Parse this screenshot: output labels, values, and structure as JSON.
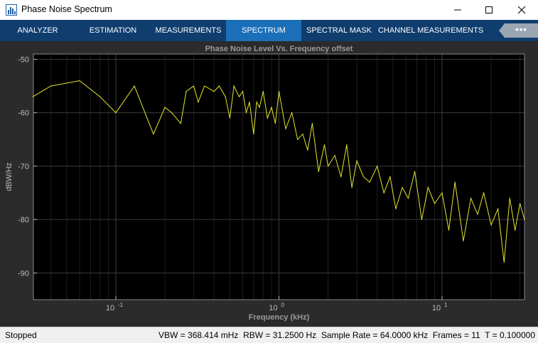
{
  "window": {
    "title": "Phase Noise Spectrum"
  },
  "toolstrip": {
    "tabs": [
      {
        "label": "ANALYZER",
        "active": false
      },
      {
        "label": "ESTIMATION",
        "active": false
      },
      {
        "label": "MEASUREMENTS",
        "active": false
      },
      {
        "label": "SPECTRUM",
        "active": true
      },
      {
        "label": "SPECTRAL MASK",
        "active": false
      },
      {
        "label": "CHANNEL MEASUREMENTS",
        "active": false
      }
    ],
    "overflow_label": "•••"
  },
  "colors": {
    "toolstrip": "#0e3d6e",
    "active_tab": "#1b6fb8",
    "trace": "#e6e62e",
    "plot_bg": "#000000",
    "figure_bg": "#2b2b2b"
  },
  "chart_data": {
    "type": "line",
    "title": "Phase Noise Level Vs. Frequency offset",
    "xlabel": "Frequency (kHz)",
    "ylabel": "dBW/Hz",
    "xscale": "log",
    "xlim": [
      0.03125,
      32
    ],
    "ylim": [
      -95,
      -49
    ],
    "yticks": [
      "-50",
      "-60",
      "-70",
      "-80",
      "-90"
    ],
    "xticks": [
      "10",
      "10",
      "10"
    ],
    "xtick_exponents": [
      "-1",
      "0",
      "1"
    ],
    "grid": true,
    "series": [
      {
        "color": "#e6e62e",
        "x": [
          0.031,
          0.04,
          0.06,
          0.08,
          0.1,
          0.13,
          0.17,
          0.2,
          0.22,
          0.25,
          0.27,
          0.3,
          0.32,
          0.35,
          0.4,
          0.43,
          0.47,
          0.5,
          0.53,
          0.57,
          0.6,
          0.63,
          0.66,
          0.7,
          0.73,
          0.76,
          0.8,
          0.85,
          0.9,
          0.95,
          1.0,
          1.1,
          1.2,
          1.3,
          1.4,
          1.5,
          1.6,
          1.75,
          1.9,
          2.0,
          2.2,
          2.4,
          2.6,
          2.8,
          3.0,
          3.3,
          3.6,
          4.0,
          4.4,
          4.8,
          5.2,
          5.7,
          6.2,
          6.8,
          7.5,
          8.2,
          9.0,
          10.0,
          11.0,
          12.0,
          13.5,
          15.0,
          16.5,
          18.0,
          20.0,
          22.0,
          24.0,
          26.0,
          28.0,
          30.0,
          32.0
        ],
        "y": [
          -57,
          -55,
          -54,
          -57,
          -60,
          -55,
          -64,
          -59,
          -60,
          -62,
          -56,
          -55,
          -58,
          -55,
          -56,
          -55,
          -57,
          -61,
          -55,
          -57,
          -56,
          -60,
          -58,
          -64,
          -58,
          -59,
          -56,
          -61,
          -59,
          -62,
          -56,
          -63,
          -60,
          -65,
          -64,
          -67,
          -62,
          -71,
          -66,
          -70,
          -68,
          -72,
          -66,
          -74,
          -69,
          -72,
          -73,
          -70,
          -75,
          -72,
          -78,
          -74,
          -76,
          -71,
          -80,
          -74,
          -77,
          -75,
          -82,
          -73,
          -84,
          -76,
          -79,
          -75,
          -81,
          -78,
          -88,
          -76,
          -82,
          -77,
          -80
        ]
      }
    ]
  },
  "status": {
    "state": "Stopped",
    "info": "VBW = 368.414 mHz  RBW = 31.2500 Hz  Sample Rate = 64.0000 kHz  Frames = 11  T = 0.100000"
  }
}
